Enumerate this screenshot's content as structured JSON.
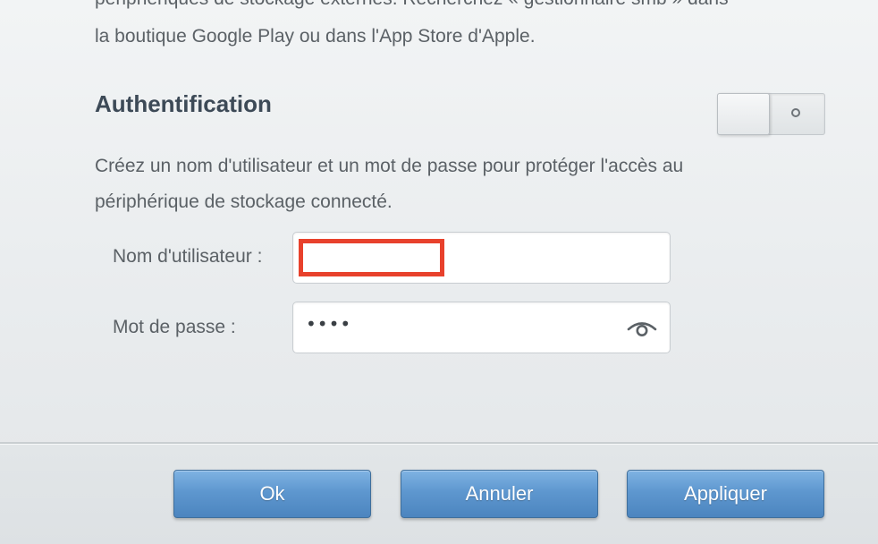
{
  "intro": {
    "line1": "périphériques de stockage externes. Recherchez « gestionnaire smb » dans",
    "line2": "la boutique Google Play ou dans l'App Store d'Apple."
  },
  "auth": {
    "title": "Authentification",
    "toggle_state": "off",
    "toggle_icon": "off-circle-icon",
    "description_line1": "Créez un nom d'utilisateur et un mot de passe pour protéger l'accès au",
    "description_line2": "périphérique de stockage connecté."
  },
  "form": {
    "username_label": "Nom d'utilisateur :",
    "username_value": "",
    "password_label": "Mot de passe :",
    "password_value": "••••",
    "password_toggle_icon": "eye-icon"
  },
  "buttons": {
    "ok": "Ok",
    "cancel": "Annuler",
    "apply": "Appliquer"
  },
  "colors": {
    "button_blue": "#5e97cf",
    "title": "#3d4a57",
    "redaction": "#e8412c"
  }
}
